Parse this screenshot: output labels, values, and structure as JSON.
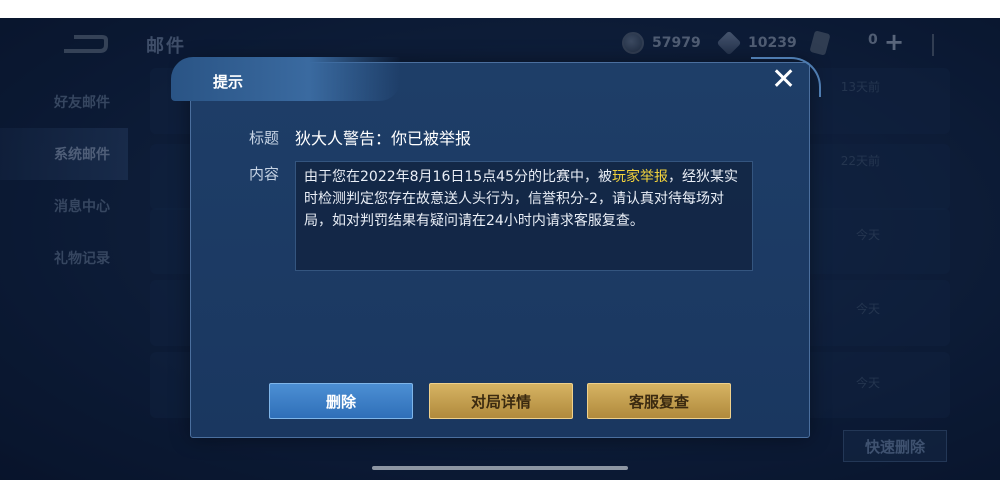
{
  "topbar": {
    "title": "邮件",
    "coins": "57979",
    "gems": "10239",
    "cards": "0"
  },
  "sidebar": {
    "items": [
      {
        "label": "好友邮件"
      },
      {
        "label": "系统邮件"
      },
      {
        "label": "消息中心"
      },
      {
        "label": "礼物记录"
      }
    ]
  },
  "mail_list": {
    "dates": [
      "13天前",
      "22天前",
      "今天",
      "今天",
      "今天"
    ],
    "quick_delete_label": "快速删除"
  },
  "dialog": {
    "title": "提示",
    "close_symbol": "✕",
    "subject_label": "标题",
    "subject": "狄大人警告：你已被举报",
    "content_label": "内容",
    "content_before": "由于您在2022年8月16日15点45分的比赛中，被",
    "content_highlight": "玩家举报",
    "content_after": "，经狄某实时检测判定您存在故意送人头行为，信誉积分-2，请认真对待每场对局，如对判罚结果有疑问请在24小时内请求客服复查。",
    "buttons": {
      "delete": "删除",
      "match_details": "对局详情",
      "support_review": "客服复查"
    }
  },
  "colors": {
    "highlight": "#f2d23c",
    "accent_blue": "#2f6fb8",
    "accent_gold": "#b08a3c"
  }
}
